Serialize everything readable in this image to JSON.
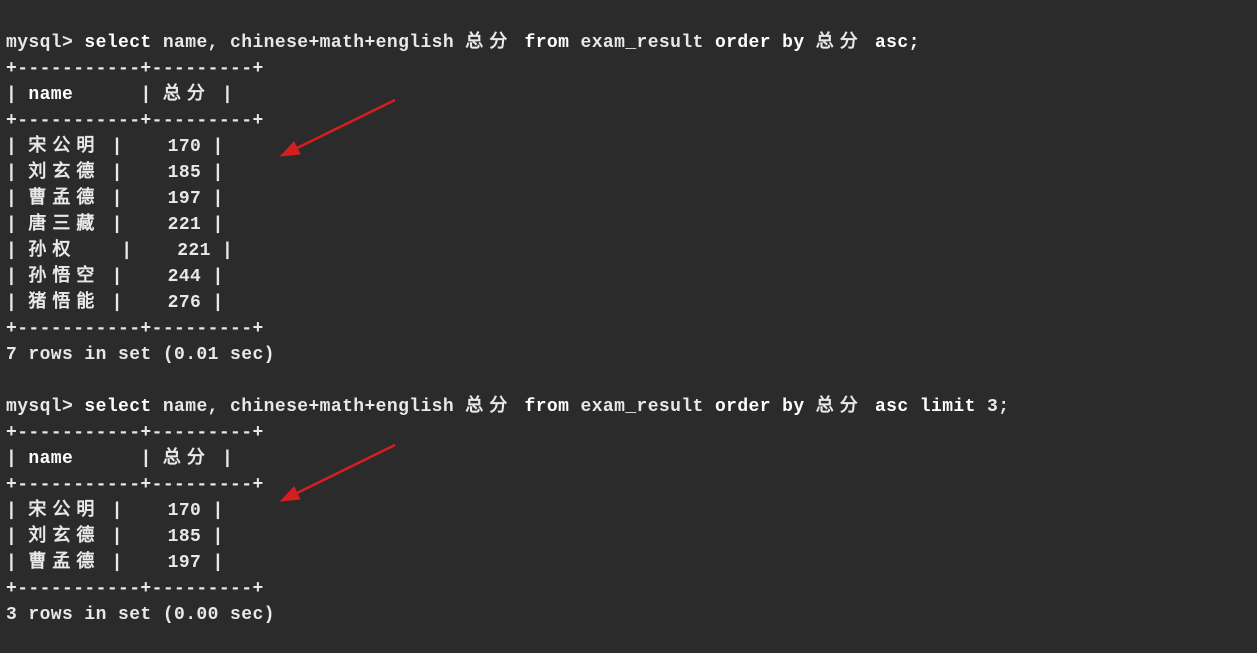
{
  "prompt": "mysql>",
  "query1": {
    "text_parts": {
      "p1": "select",
      "p2": "name, chinese+math+english",
      "alias": "总分",
      "p3": "from",
      "p4": "exam_result",
      "p5": "order by",
      "alias2": "总分",
      "p6": "asc;"
    },
    "columns": {
      "c1": "name",
      "c2": "总分"
    },
    "rows": [
      {
        "name": "宋公明",
        "score": "170"
      },
      {
        "name": "刘玄德",
        "score": "185"
      },
      {
        "name": "曹孟德",
        "score": "197"
      },
      {
        "name": "唐三藏",
        "score": "221"
      },
      {
        "name": "孙权",
        "score": "221"
      },
      {
        "name": "孙悟空",
        "score": "244"
      },
      {
        "name": "猪悟能",
        "score": "276"
      }
    ],
    "footer": "7 rows in set (0.01 sec)"
  },
  "query2": {
    "text_parts": {
      "p1": "select",
      "p2": "name, chinese+math+english",
      "alias": "总分",
      "p3": "from",
      "p4": "exam_result",
      "p5": "order by",
      "alias2": "总分",
      "p6": "asc",
      "p7": "limit",
      "p8": "3;"
    },
    "columns": {
      "c1": "name",
      "c2": "总分"
    },
    "rows": [
      {
        "name": "宋公明",
        "score": "170"
      },
      {
        "name": "刘玄德",
        "score": "185"
      },
      {
        "name": "曹孟德",
        "score": "197"
      }
    ],
    "footer": "3 rows in set (0.00 sec)"
  },
  "border": {
    "sep": "+-----------+---------+",
    "pipe": "|"
  },
  "arrow_color": "#d71e1e"
}
